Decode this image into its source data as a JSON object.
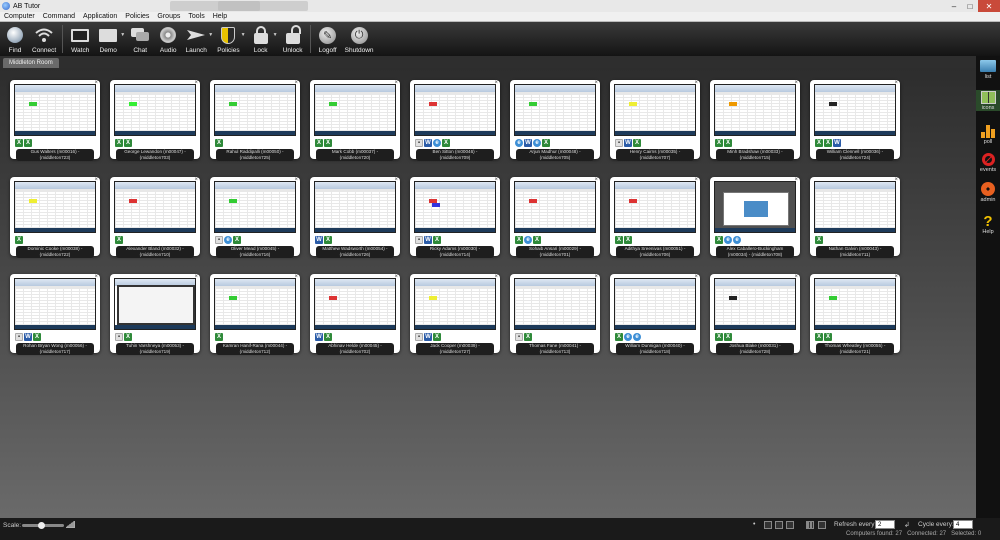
{
  "window": {
    "title": "AB Tutor",
    "controls": {
      "minimize": "–",
      "maximize": "□",
      "close": "✕"
    }
  },
  "menu": [
    "Computer",
    "Command",
    "Application",
    "Policies",
    "Groups",
    "Tools",
    "Help"
  ],
  "toolbar": {
    "buttons": [
      {
        "label": "Find",
        "icon": "globe-icon"
      },
      {
        "label": "Connect",
        "icon": "wifi-icon"
      },
      {
        "label": "Watch",
        "icon": "monitor-icon"
      },
      {
        "label": "Demo",
        "icon": "presentation-icon"
      },
      {
        "label": "Chat",
        "icon": "chat-icon"
      },
      {
        "label": "Audio",
        "icon": "audio-icon"
      },
      {
        "label": "Launch",
        "icon": "launch-icon"
      },
      {
        "label": "Policies",
        "icon": "shield-icon"
      },
      {
        "label": "Lock",
        "icon": "lock-icon"
      },
      {
        "label": "Unlock",
        "icon": "unlock-icon"
      },
      {
        "label": "Logoff",
        "icon": "logoff-icon"
      },
      {
        "label": "Shutdown",
        "icon": "power-icon"
      }
    ]
  },
  "room_tab": "Middleton Room",
  "computers": [
    {
      "line1": "Gus Walters (m00016) -",
      "line2": "(middleton723)",
      "apps": [
        "excel",
        "excel"
      ],
      "screen": "excel",
      "marks": [
        "#3c3"
      ]
    },
    {
      "line1": "George Lewandon (m00047) -",
      "line2": "(middleton703)",
      "apps": [
        "excel",
        "excel"
      ],
      "screen": "excel",
      "marks": [
        "#3e3"
      ]
    },
    {
      "line1": "Rahul Raddipalli (m00050) -",
      "line2": "(middleton725)",
      "apps": [
        "excel"
      ],
      "screen": "excel",
      "marks": [
        "#3c3"
      ]
    },
    {
      "line1": "Mark Cobb (m00037) -",
      "line2": "(middleton720)",
      "apps": [
        "excel",
        "excel"
      ],
      "screen": "excel",
      "marks": [
        "#3c3"
      ]
    },
    {
      "line1": "Ben Sitton (m00046) -",
      "line2": "(middleton709)",
      "apps": [
        "other",
        "word",
        "ie",
        "excel"
      ],
      "screen": "excel",
      "marks": [
        "#d33"
      ]
    },
    {
      "line1": "Arjun Madhur (m00048) -",
      "line2": "(middleton705)",
      "apps": [
        "ie",
        "word",
        "ie",
        "excel"
      ],
      "screen": "excel",
      "marks": [
        "#3c3"
      ]
    },
    {
      "line1": "Henry Cairns (m00035) -",
      "line2": "(middleton707)",
      "apps": [
        "other",
        "word",
        "excel"
      ],
      "screen": "excel",
      "marks": [
        "#ee3"
      ]
    },
    {
      "line1": "Minh Bradshaw (m00033) -",
      "line2": "(middleton715)",
      "apps": [
        "excel",
        "excel"
      ],
      "screen": "excel",
      "marks": [
        "#e90"
      ]
    },
    {
      "line1": "William Clennell (m00036) -",
      "line2": "(middleton724)",
      "apps": [
        "excel",
        "excel",
        "word"
      ],
      "screen": "excel",
      "marks": [
        "#222"
      ]
    },
    {
      "line1": "Dominic Cooke (m00038) -",
      "line2": "(middleton722)",
      "apps": [
        "excel"
      ],
      "screen": "excel",
      "marks": [
        "#ee3"
      ]
    },
    {
      "line1": "Alexander Bland (m00032) -",
      "line2": "(middleton710)",
      "apps": [
        "excel"
      ],
      "screen": "excel",
      "marks": [
        "#d33"
      ]
    },
    {
      "line1": "Oliver Mead (m00045) -",
      "line2": "(middleton716)",
      "apps": [
        "other",
        "ie",
        "excel"
      ],
      "screen": "excel",
      "marks": [
        "#3c3"
      ]
    },
    {
      "line1": "Matthew Wadsworth (m00054) -",
      "line2": "(middleton726)",
      "apps": [
        "word",
        "excel"
      ],
      "screen": "excel",
      "marks": []
    },
    {
      "line1": "Ricky Adams (m00030) -",
      "line2": "(middleton714)",
      "apps": [
        "other",
        "word",
        "excel"
      ],
      "screen": "excel",
      "marks": [
        "#d33",
        "#33d"
      ]
    },
    {
      "line1": "Sohaib Ansari (m00029) -",
      "line2": "(middleton701)",
      "apps": [
        "excel",
        "ie",
        "excel"
      ],
      "screen": "excel",
      "marks": [
        "#d33"
      ]
    },
    {
      "line1": "Adithya Sreenivas (m00051) -",
      "line2": "(middleton706)",
      "apps": [
        "excel",
        "excel"
      ],
      "screen": "excel",
      "marks": [
        "#d33"
      ]
    },
    {
      "line1": "Alex Caballero-Buckingham",
      "line2": "(m00034) - (middleton708)",
      "apps": [
        "excel",
        "ie",
        "ie"
      ],
      "screen": "browser",
      "marks": []
    },
    {
      "line1": "Nathan Galvin (m00043) -",
      "line2": "(middleton711)",
      "apps": [
        "excel"
      ],
      "screen": "excel",
      "marks": []
    },
    {
      "line1": "Rohan Bryan Wong (m00056) -",
      "line2": "(middleton717)",
      "apps": [
        "other",
        "word",
        "excel"
      ],
      "screen": "excel",
      "marks": []
    },
    {
      "line1": "Tuhin Varshneya (m00053) -",
      "line2": "(middleton719)",
      "apps": [
        "other",
        "excel"
      ],
      "screen": "sheet",
      "marks": []
    },
    {
      "line1": "Kamran Hanif-Rana (m00044) -",
      "line2": "(middleton712)",
      "apps": [
        "excel"
      ],
      "screen": "excel",
      "marks": [
        "#3c3"
      ]
    },
    {
      "line1": "Abhinav Helde (m00045) -",
      "line2": "(middleton702)",
      "apps": [
        "word",
        "excel"
      ],
      "screen": "excel",
      "marks": [
        "#d33"
      ]
    },
    {
      "line1": "Jack Cooper (m00039) -",
      "line2": "(middleton727)",
      "apps": [
        "other",
        "word",
        "excel"
      ],
      "screen": "excel",
      "marks": [
        "#ee3"
      ]
    },
    {
      "line1": "Thomas Fane (m00041) -",
      "line2": "(middleton713)",
      "apps": [
        "other",
        "excel"
      ],
      "screen": "excel",
      "marks": []
    },
    {
      "line1": "William Dunnigan (m00040) -",
      "line2": "(middleton718)",
      "apps": [
        "excel",
        "ie",
        "ie"
      ],
      "screen": "excel",
      "marks": []
    },
    {
      "line1": "Joshua Blake (m00031) -",
      "line2": "(middleton728)",
      "apps": [
        "excel",
        "excel"
      ],
      "screen": "excel",
      "marks": [
        "#222"
      ]
    },
    {
      "line1": "Thomas Wheatley (m00055) -",
      "line2": "(middleton721)",
      "apps": [
        "excel",
        "excel"
      ],
      "screen": "excel",
      "marks": [
        "#3c3"
      ]
    }
  ],
  "sidebar": [
    {
      "label": "list",
      "icon": "list-icon"
    },
    {
      "label": "icons",
      "icon": "icons-view-icon"
    },
    {
      "label": "poll",
      "icon": "poll-icon"
    },
    {
      "label": "events",
      "icon": "events-icon"
    },
    {
      "label": "admin",
      "icon": "admin-gear-icon"
    },
    {
      "label": "Help",
      "icon": "help-icon"
    }
  ],
  "status": {
    "scale_label": "Scale:",
    "refresh_label": "Refresh every:",
    "refresh_value": "2",
    "cycle_label": "Cycle every:",
    "cycle_value": "4",
    "found_label": "Computers found:",
    "found": "27",
    "connected_label": "Connected:",
    "connected": "27",
    "selected_label": "Selected:",
    "selected": "0"
  }
}
